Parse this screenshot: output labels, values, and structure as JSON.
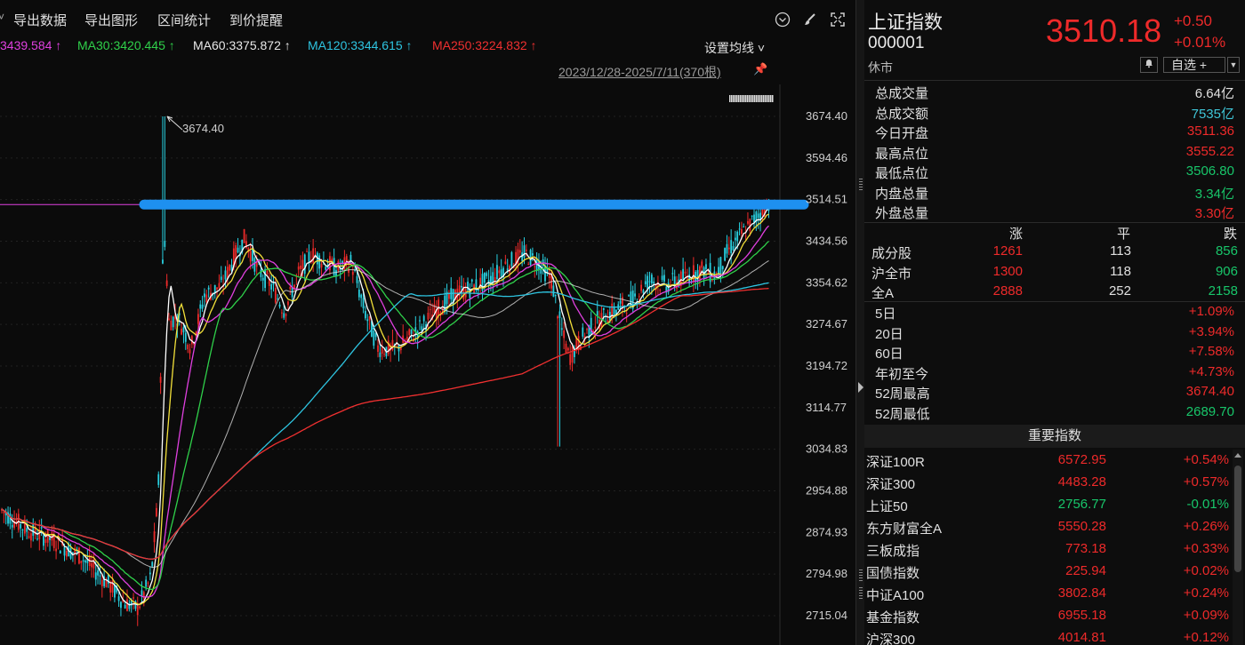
{
  "toolbar": {
    "export_data": "导出数据",
    "export_chart": "导出图形",
    "range_stats": "区间统计",
    "price_alert": "到价提醒"
  },
  "ma_line": {
    "ma_first": "3439.584 ↑",
    "ma30": "MA30:3420.445 ↑",
    "ma60": "MA60:3375.872 ↑",
    "ma120": "MA120:3344.615 ↑",
    "ma250": "MA250:3224.832 ↑",
    "setup_label": "设置均线 ˅",
    "colors": {
      "ma_first": "#e040e0",
      "ma30": "#2fd04a",
      "ma60": "#e8e8e8",
      "ma120": "#2ec4e0",
      "ma250": "#f03030"
    }
  },
  "range_label": "2023/12/28-2025/7/11(370根)",
  "chart_data": {
    "type": "candlestick",
    "y_axis_ticks": [
      "3674.40",
      "3594.46",
      "3514.51",
      "3434.56",
      "3354.62",
      "3274.67",
      "3194.72",
      "3114.77",
      "3034.83",
      "2954.88",
      "2874.93",
      "2794.98",
      "2715.04"
    ],
    "ylim": [
      2715.04,
      3674.4
    ],
    "peak_annotation": "3674.40",
    "peak_value": 3674.4,
    "horizontal_level": 3505,
    "series": [
      {
        "name": "MA30",
        "color": "#2fd04a"
      },
      {
        "name": "MA60",
        "color": "#e8e8e8"
      },
      {
        "name": "MA120",
        "color": "#2ec4e0"
      },
      {
        "name": "MA250",
        "color": "#f03030"
      }
    ]
  },
  "quote": {
    "name": "上证指数",
    "code": "000001",
    "status": "休市",
    "price": "3510.18",
    "change": "+0.50",
    "change_pct": "+0.01%",
    "watch_label": "自选 +"
  },
  "stats": [
    {
      "k": "总成交量",
      "v": "6.64亿",
      "c": "white"
    },
    {
      "k": "总成交额",
      "v": "7535亿",
      "c": "teal"
    },
    {
      "k": "今日开盘",
      "v": "3511.36",
      "c": "red"
    },
    {
      "k": "最高点位",
      "v": "3555.22",
      "c": "red"
    },
    {
      "k": "最低点位",
      "v": "3506.80",
      "c": "green"
    },
    {
      "k": "内盘总量",
      "v": "3.34亿",
      "c": "green"
    },
    {
      "k": "外盘总量",
      "v": "3.30亿",
      "c": "red"
    }
  ],
  "breadth": {
    "head_up": "涨",
    "head_flat": "平",
    "head_down": "跌",
    "rows": [
      {
        "k": "成分股",
        "u": "1261",
        "f": "113",
        "d": "856"
      },
      {
        "k": "沪全市",
        "u": "1300",
        "f": "118",
        "d": "906"
      },
      {
        "k": "全A",
        "u": "2888",
        "f": "252",
        "d": "2158"
      }
    ]
  },
  "periods": [
    {
      "k": "5日",
      "v": "+1.09%",
      "c": "red"
    },
    {
      "k": "20日",
      "v": "+3.94%",
      "c": "red"
    },
    {
      "k": "60日",
      "v": "+7.58%",
      "c": "red"
    },
    {
      "k": "年初至今",
      "v": "+4.73%",
      "c": "red"
    },
    {
      "k": "52周最高",
      "v": "3674.40",
      "c": "red"
    },
    {
      "k": "52周最低",
      "v": "2689.70",
      "c": "green"
    }
  ],
  "indices_title": "重要指数",
  "indices": [
    {
      "n": "深证100R",
      "p": "6572.95",
      "c": "+0.54%",
      "clr": "red"
    },
    {
      "n": "深证300",
      "p": "4483.28",
      "c": "+0.57%",
      "clr": "red"
    },
    {
      "n": "上证50",
      "p": "2756.77",
      "c": "-0.01%",
      "clr": "green"
    },
    {
      "n": "东方财富全A",
      "p": "5550.28",
      "c": "+0.26%",
      "clr": "red"
    },
    {
      "n": "三板成指",
      "p": "773.18",
      "c": "+0.33%",
      "clr": "red"
    },
    {
      "n": "国债指数",
      "p": "225.94",
      "c": "+0.02%",
      "clr": "red"
    },
    {
      "n": "中证A100",
      "p": "3802.84",
      "c": "+0.24%",
      "clr": "red"
    },
    {
      "n": "基金指数",
      "p": "6955.18",
      "c": "+0.09%",
      "clr": "red"
    },
    {
      "n": "沪深300",
      "p": "4014.81",
      "c": "+0.12%",
      "clr": "red"
    }
  ]
}
